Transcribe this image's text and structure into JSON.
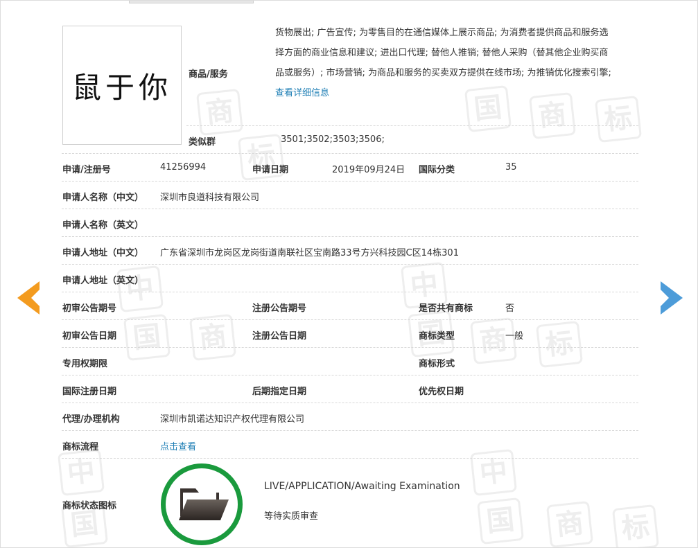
{
  "trademark": {
    "image_text": "鼠于你",
    "goods_label": "商品/服务",
    "goods_lines": [
      "货物展出; 广告宣传; 为零售目的在通信媒体上展示商品; 为消费者提供商品和服务选",
      "择方面的商业信息和建议; 进出口代理; 替他人推销; 替他人采购（替其他企业购买商",
      "品或服务）; 市场营销; 为商品和服务的买卖双方提供在线市场; 为推销优化搜索引擎;"
    ],
    "details_link": "查看详细信息",
    "similar_group_label": "类似群",
    "similar_group_value": "3501;3502;3503;3506;"
  },
  "fields": {
    "reg_no_label": "申请/注册号",
    "reg_no_value": "41256994",
    "apply_date_label": "申请日期",
    "apply_date_value": "2019年09月24日",
    "intl_class_label": "国际分类",
    "intl_class_value": "35",
    "applicant_cn_label": "申请人名称（中文）",
    "applicant_cn_value": "深圳市良道科技有限公司",
    "applicant_en_label": "申请人名称（英文）",
    "address_cn_label": "申请人地址（中文）",
    "address_cn_value": "广东省深圳市龙岗区龙岗街道南联社区宝南路33号方兴科技园C区14栋301",
    "address_en_label": "申请人地址（英文）",
    "prelim_no_label": "初审公告期号",
    "reg_pub_no_label": "注册公告期号",
    "shared_label": "是否共有商标",
    "shared_value": "否",
    "prelim_date_label": "初审公告日期",
    "reg_pub_date_label": "注册公告日期",
    "tm_type_label": "商标类型",
    "tm_type_value": "一般",
    "exclusive_label": "专用权期限",
    "tm_form_label": "商标形式",
    "intl_reg_date_label": "国际注册日期",
    "later_date_label": "后期指定日期",
    "priority_label": "优先权日期",
    "agent_label": "代理/办理机构",
    "agent_value": "深圳市凯诺达知识产权代理有限公司",
    "flow_label": "商标流程",
    "flow_link": "点击查看",
    "status_label": "商标状态图标",
    "status_en": "LIVE/APPLICATION/Awaiting Examination",
    "status_cn": "等待实质审查"
  },
  "watermark": [
    "中",
    "国",
    "商",
    "标"
  ],
  "icons": {
    "prev": "arrow-left-icon",
    "next": "arrow-right-icon",
    "status": "folder-icon"
  },
  "colors": {
    "prev_arrow": "#f39b1f",
    "next_arrow": "#4d9cd9",
    "status_ring": "#1a9a3d",
    "link": "#1f7fb5"
  }
}
